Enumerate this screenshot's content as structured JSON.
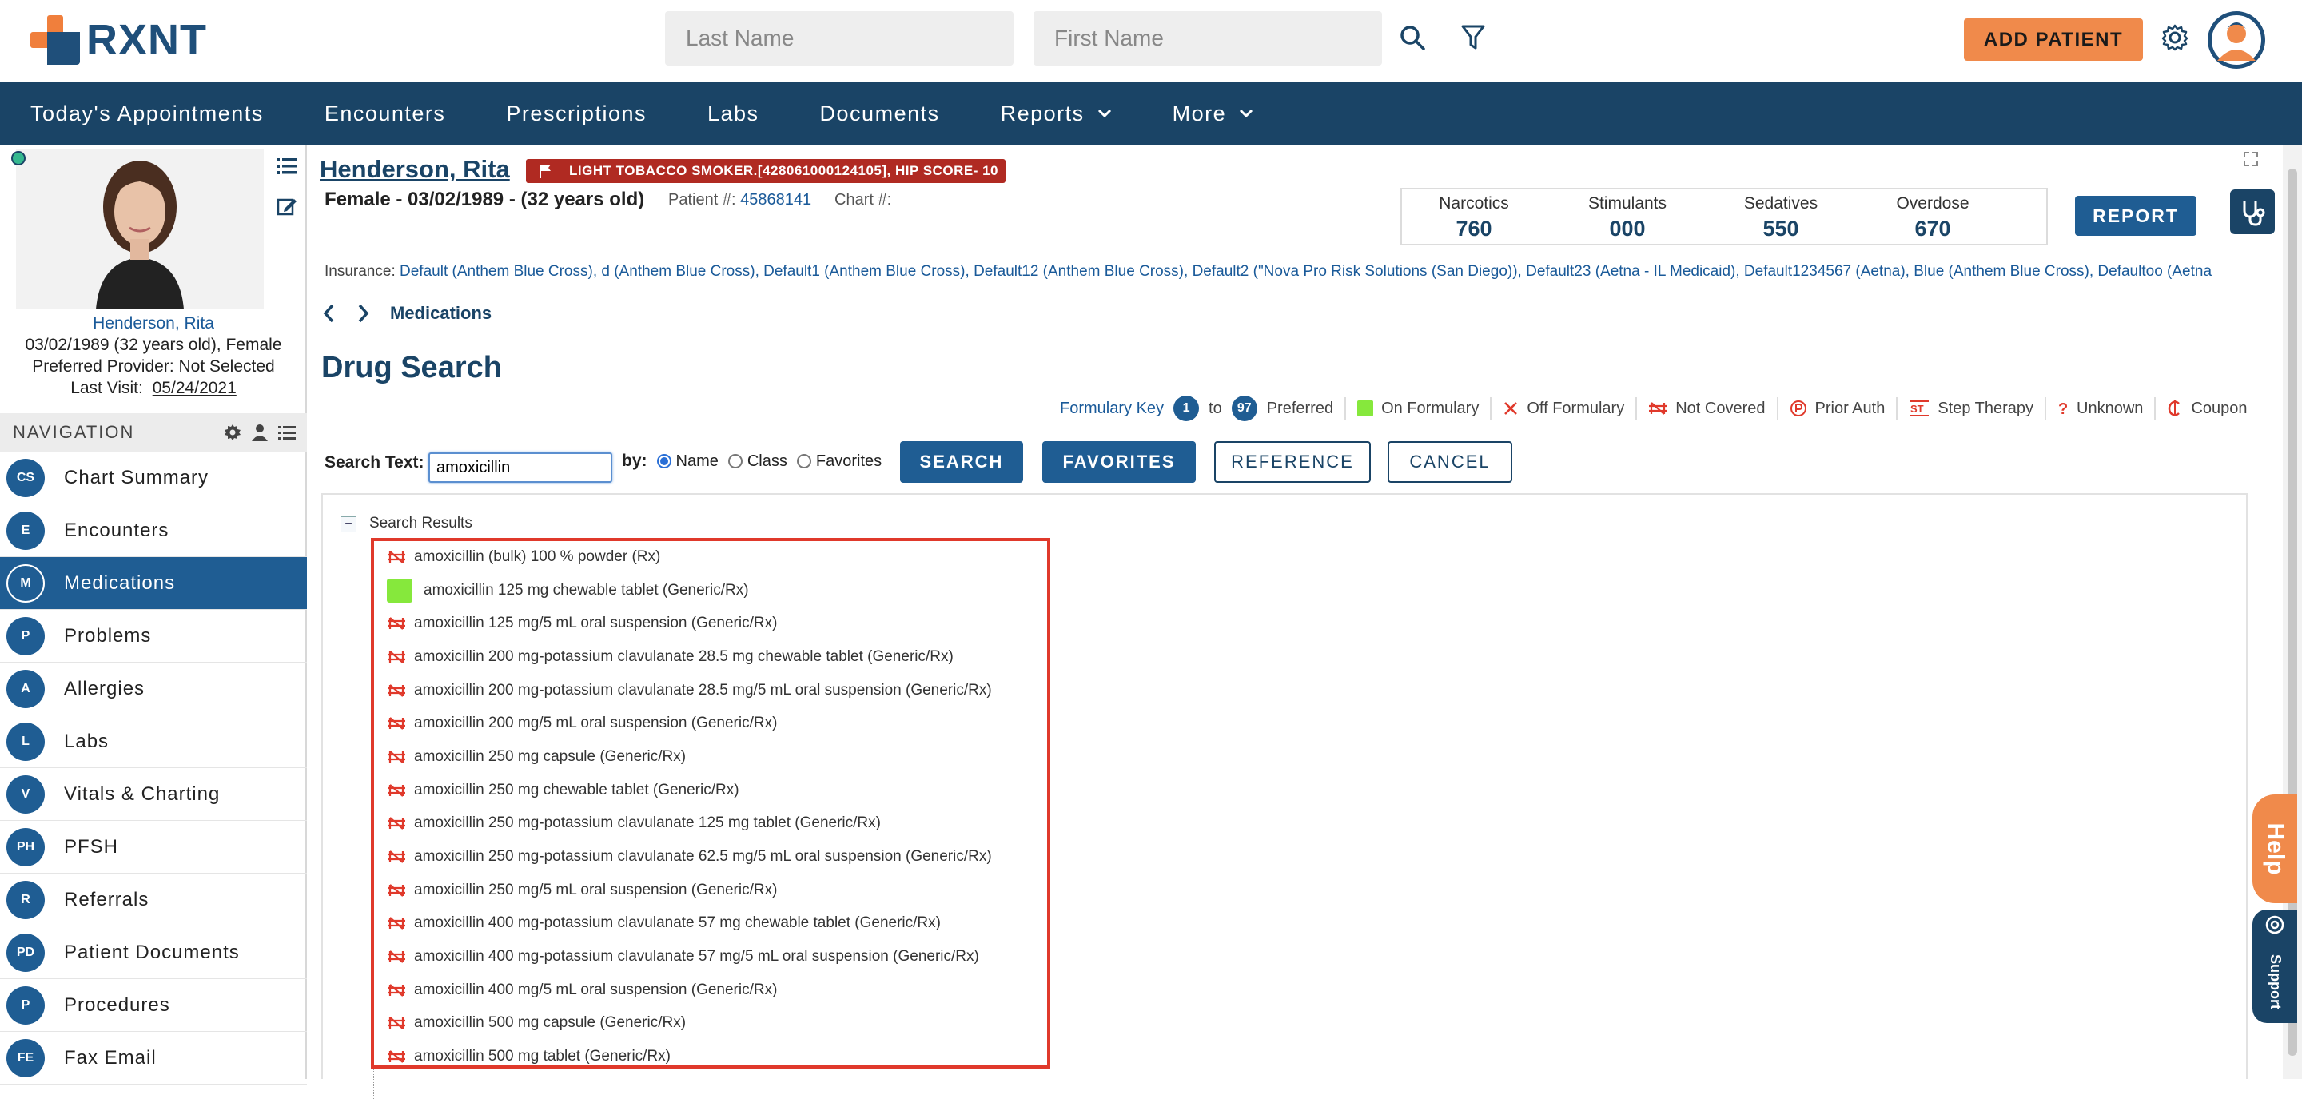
{
  "header": {
    "logo_text": "RXNT",
    "last_name_placeholder": "Last Name",
    "first_name_placeholder": "First Name",
    "add_patient_label": "ADD PATIENT",
    "brand_color": "#1f4f7a",
    "accent_color": "#f08a4b"
  },
  "nav": {
    "items": [
      {
        "label": "Today's Appointments",
        "dropdown": false
      },
      {
        "label": "Encounters",
        "dropdown": false
      },
      {
        "label": "Prescriptions",
        "dropdown": false
      },
      {
        "label": "Labs",
        "dropdown": false
      },
      {
        "label": "Documents",
        "dropdown": false
      },
      {
        "label": "Reports",
        "dropdown": true
      },
      {
        "label": "More",
        "dropdown": true
      }
    ]
  },
  "patient_card": {
    "name": "Henderson, Rita",
    "dob_line": "03/02/1989 (32 years old), Female",
    "provider_line": "Preferred Provider: Not Selected",
    "last_visit_label": "Last Visit:",
    "last_visit_value": "05/24/2021"
  },
  "side_nav": {
    "header": "NAVIGATION",
    "items": [
      {
        "abbr": "CS",
        "label": "Chart Summary",
        "active": false
      },
      {
        "abbr": "E",
        "label": "Encounters",
        "active": false
      },
      {
        "abbr": "M",
        "label": "Medications",
        "active": true
      },
      {
        "abbr": "P",
        "label": "Problems",
        "active": false
      },
      {
        "abbr": "A",
        "label": "Allergies",
        "active": false
      },
      {
        "abbr": "L",
        "label": "Labs",
        "active": false
      },
      {
        "abbr": "V",
        "label": "Vitals & Charting",
        "active": false
      },
      {
        "abbr": "PH",
        "label": "PFSH",
        "active": false
      },
      {
        "abbr": "R",
        "label": "Referrals",
        "active": false
      },
      {
        "abbr": "PD",
        "label": "Patient Documents",
        "active": false
      },
      {
        "abbr": "P",
        "label": "Procedures",
        "active": false
      },
      {
        "abbr": "FE",
        "label": "Fax Email",
        "active": false
      }
    ]
  },
  "patient_header": {
    "name": "Henderson, Rita",
    "flag_text": "LIGHT TOBACCO SMOKER.[428061000124105], HIP SCORE- 10",
    "info": "Female - 03/02/1989 - (32 years old)",
    "patient_num_label": "Patient #:",
    "patient_num_value": "45868141",
    "chart_num_label": "Chart #:",
    "stats": [
      {
        "label": "Narcotics",
        "value": "760"
      },
      {
        "label": "Stimulants",
        "value": "000"
      },
      {
        "label": "Sedatives",
        "value": "550"
      },
      {
        "label": "Overdose",
        "value": "670"
      }
    ],
    "report_label": "REPORT",
    "insurance_label": "Insurance:",
    "insurance_value": "Default (Anthem Blue Cross), d (Anthem Blue Cross), Default1 (Anthem Blue Cross), Default12 (Anthem Blue Cross), Default2 (\"Nova Pro Risk Solutions (San Diego)), Default23 (Aetna - IL Medicaid), Default1234567 (Aetna), Blue (Anthem Blue Cross), Defaultoo (Aetna"
  },
  "breadcrumb": {
    "current": "Medications"
  },
  "drug_search": {
    "title": "Drug Search",
    "formulary": {
      "key_label": "Formulary Key",
      "range_from": "1",
      "range_to_word": "to",
      "range_to": "97",
      "preferred": "Preferred",
      "on_formulary": "On Formulary",
      "off_formulary": "Off Formulary",
      "not_covered": "Not Covered",
      "prior_auth": "Prior Auth",
      "step_therapy": "Step Therapy",
      "unknown": "Unknown",
      "coupon": "Coupon"
    },
    "search_label": "Search Text:",
    "search_value": "amoxicillin",
    "by_label": "by:",
    "by_options": [
      "Name",
      "Class",
      "Favorites"
    ],
    "by_selected": "Name",
    "buttons": {
      "search": "SEARCH",
      "favorites": "FAVORITES",
      "reference": "REFERENCE",
      "cancel": "CANCEL"
    },
    "results_label": "Search Results",
    "results": [
      {
        "name": "amoxicillin (bulk) 100 % powder (Rx)",
        "status": "not-covered"
      },
      {
        "name": "amoxicillin 125 mg chewable tablet (Generic/Rx)",
        "status": "on-formulary"
      },
      {
        "name": "amoxicillin 125 mg/5 mL oral suspension (Generic/Rx)",
        "status": "not-covered"
      },
      {
        "name": "amoxicillin 200 mg-potassium clavulanate 28.5 mg chewable tablet (Generic/Rx)",
        "status": "not-covered"
      },
      {
        "name": "amoxicillin 200 mg-potassium clavulanate 28.5 mg/5 mL oral suspension (Generic/Rx)",
        "status": "not-covered"
      },
      {
        "name": "amoxicillin 200 mg/5 mL oral suspension (Generic/Rx)",
        "status": "not-covered"
      },
      {
        "name": "amoxicillin 250 mg capsule (Generic/Rx)",
        "status": "not-covered"
      },
      {
        "name": "amoxicillin 250 mg chewable tablet (Generic/Rx)",
        "status": "not-covered"
      },
      {
        "name": "amoxicillin 250 mg-potassium clavulanate 125 mg tablet (Generic/Rx)",
        "status": "not-covered"
      },
      {
        "name": "amoxicillin 250 mg-potassium clavulanate 62.5 mg/5 mL oral suspension (Generic/Rx)",
        "status": "not-covered"
      },
      {
        "name": "amoxicillin 250 mg/5 mL oral suspension (Generic/Rx)",
        "status": "not-covered"
      },
      {
        "name": "amoxicillin 400 mg-potassium clavulanate 57 mg chewable tablet (Generic/Rx)",
        "status": "not-covered"
      },
      {
        "name": "amoxicillin 400 mg-potassium clavulanate 57 mg/5 mL oral suspension (Generic/Rx)",
        "status": "not-covered"
      },
      {
        "name": "amoxicillin 400 mg/5 mL oral suspension (Generic/Rx)",
        "status": "not-covered"
      },
      {
        "name": "amoxicillin 500 mg capsule (Generic/Rx)",
        "status": "not-covered"
      },
      {
        "name": "amoxicillin 500 mg tablet (Generic/Rx)",
        "status": "not-covered"
      }
    ]
  },
  "floating": {
    "help_label": "Help",
    "support_label": "Support"
  }
}
